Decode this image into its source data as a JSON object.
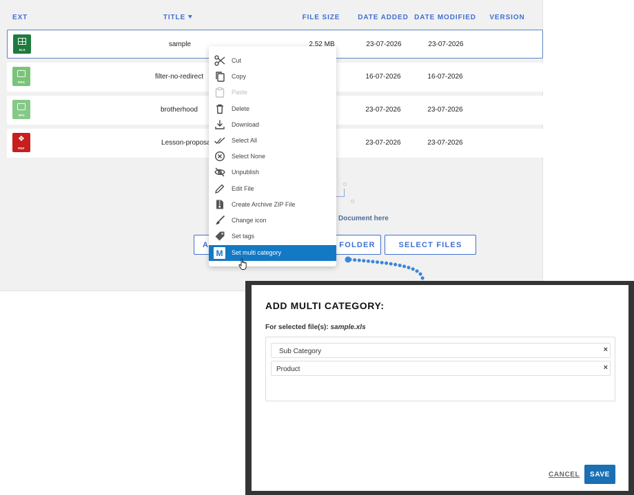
{
  "table": {
    "headers": {
      "ext": "EXT",
      "title": "TITLE",
      "file_size": "FILE SIZE",
      "date_added": "DATE ADDED",
      "date_modified": "DATE MODIFIED",
      "version": "VERSION"
    },
    "rows": [
      {
        "ext": "XLS",
        "icon_color": "#1e7b3f",
        "title": "sample",
        "file_size": "2.52 MB",
        "date_added": "23-07-2026",
        "date_modified": "23-07-2026"
      },
      {
        "ext": "PNG",
        "icon_color": "#7cc37a",
        "title": "filter-no-redirect",
        "file_size": "",
        "date_added": "16-07-2026",
        "date_modified": "16-07-2026"
      },
      {
        "ext": "JPG",
        "icon_color": "#86c888",
        "title": "brotherhood",
        "file_size": "",
        "date_added": "23-07-2026",
        "date_modified": "23-07-2026"
      },
      {
        "ext": "PDF",
        "icon_color": "#c81e1e",
        "title": "Lesson-proposal",
        "file_size": "",
        "date_added": "23-07-2026",
        "date_modified": "23-07-2026"
      }
    ]
  },
  "dropzone": {
    "text": "Document here",
    "btn_left": "A",
    "btn_folder": "FOLDER",
    "btn_select_files": "SELECT FILES"
  },
  "context_menu": {
    "items": [
      {
        "label": "Cut",
        "icon": "scissors-icon"
      },
      {
        "label": "Copy",
        "icon": "copy-icon"
      },
      {
        "label": "Paste",
        "icon": "paste-icon",
        "disabled": true
      },
      {
        "label": "Delete",
        "icon": "trash-icon"
      },
      {
        "label": "Download",
        "icon": "download-icon"
      },
      {
        "label": "Select All",
        "icon": "double-check-icon"
      },
      {
        "label": "Select None",
        "icon": "circle-x-icon"
      },
      {
        "label": "Unpublish",
        "icon": "eye-off-icon"
      },
      {
        "label": "Edit File",
        "icon": "pencil-icon"
      },
      {
        "label": "Create Archive ZIP File",
        "icon": "zip-file-icon"
      },
      {
        "label": "Change icon",
        "icon": "brush-icon"
      },
      {
        "label": "Set tags",
        "icon": "tag-icon"
      },
      {
        "label": "Set multi category",
        "icon": "m-icon",
        "active": true
      }
    ],
    "m_letter": "M"
  },
  "modal": {
    "title": "ADD MULTI CATEGORY:",
    "subtitle_prefix": "For selected file(s):",
    "subtitle_file": "sample.xls",
    "tags": [
      "Sub Category",
      "Product"
    ],
    "tag_remove": "×",
    "cancel_label": "CANCEL",
    "save_label": "SAVE"
  },
  "colors": {
    "accent": "#3f6fd2",
    "menu_active": "#1479c4",
    "save_button": "#1b6fb3",
    "arrow": "#3b86d6"
  }
}
